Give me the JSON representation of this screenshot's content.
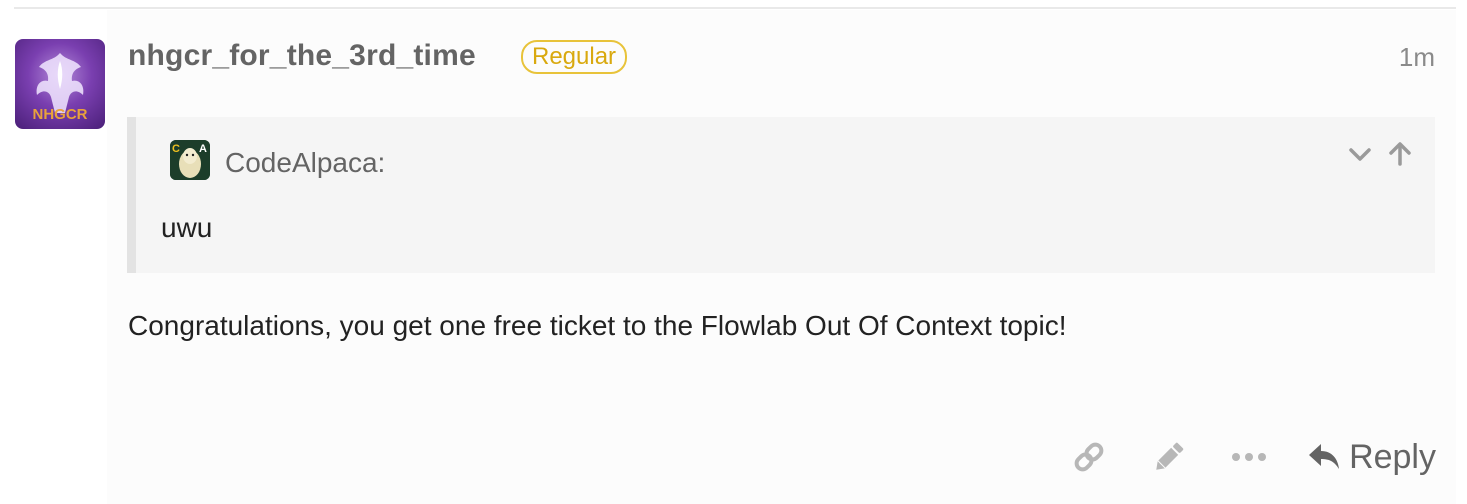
{
  "post": {
    "username": "nhgcr_for_the_3rd_time",
    "badge": "Regular",
    "timestamp": "1m",
    "avatar_text": "NHGCR",
    "quote": {
      "author": "CodeAlpaca:",
      "avatar_letters": "CA",
      "text": "uwu"
    },
    "body": "Congratulations, you get one free ticket to the Flowlab Out Of Context topic!",
    "actions": {
      "icons": [
        "link-icon",
        "pencil-icon",
        "more-icon"
      ],
      "reply_label": "Reply"
    }
  },
  "colors": {
    "badge": "#e8c33a",
    "username": "#646464",
    "quote_bg": "#f5f5f5",
    "quote_border": "#e3e3e3"
  }
}
